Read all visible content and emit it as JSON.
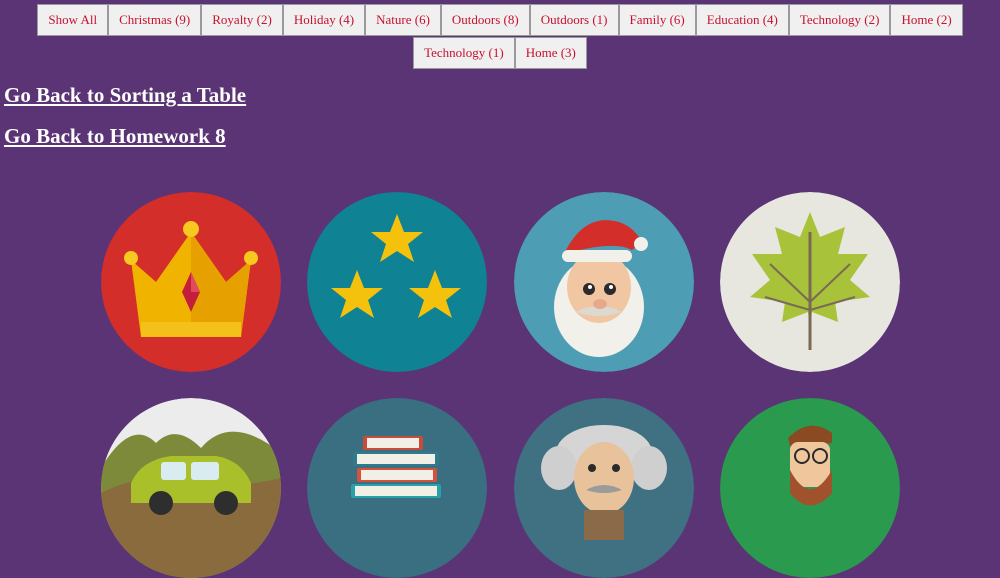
{
  "filters": {
    "row1": [
      "Show All",
      "Christmas (9)",
      "Royalty (2)",
      "Holiday (4)",
      "Nature (6)",
      "Outdoors (8)",
      "Outdoors (1)",
      "Family (6)",
      "Education (4)",
      "Technology (2)",
      "Home (2)"
    ],
    "row2": [
      "Technology (1)",
      "Home (3)"
    ]
  },
  "links": {
    "sorting_table": "Go Back to Sorting a Table",
    "homework8": "Go Back to Homework 8"
  },
  "gallery": [
    {
      "icon": "crown-icon",
      "bg": "#d42e2a"
    },
    {
      "icon": "stars-icon",
      "bg": "#0f8394"
    },
    {
      "icon": "santa-icon",
      "bg": "#4d9eb4"
    },
    {
      "icon": "leaf-icon",
      "bg": "#e8e7df"
    },
    {
      "icon": "car-icon",
      "bg": "#ececec"
    },
    {
      "icon": "books-icon",
      "bg": "#3a6f82"
    },
    {
      "icon": "einstein-icon",
      "bg": "#3f7182"
    },
    {
      "icon": "hipster-man-icon",
      "bg": "#2a9a4e"
    }
  ],
  "colors": {
    "page_bg": "#5a3475",
    "filter_text": "#c8102e",
    "filter_bg": "#f0f0f0",
    "link_text": "#ffffff"
  }
}
